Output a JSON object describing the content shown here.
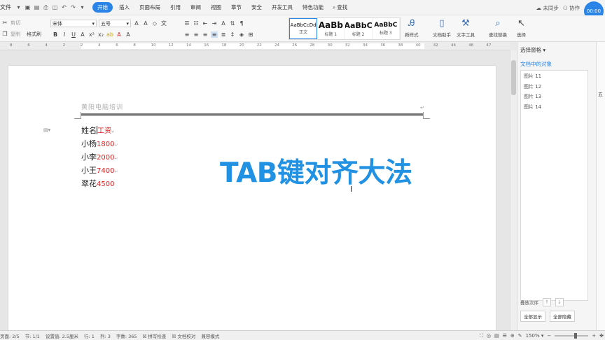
{
  "menu": {
    "file": "文件",
    "tabs": [
      "开始",
      "插入",
      "页面布局",
      "引用",
      "审阅",
      "视图",
      "章节",
      "安全",
      "开发工具",
      "特色功能"
    ],
    "active_tab": "开始",
    "search": "查找",
    "sync": "未同步",
    "collab": "协作",
    "timer": "00:00"
  },
  "ribbon": {
    "cut": "剪切",
    "copy": "复制",
    "format_painter": "格式刷",
    "font_name": "宋体",
    "font_size": "五号",
    "styles": [
      {
        "sample": "AaBbCcDd",
        "name": "正文"
      },
      {
        "sample": "AaBb",
        "name": "标题 1"
      },
      {
        "sample": "AaBbC",
        "name": "标题 2"
      },
      {
        "sample": "AaBbC",
        "name": "标题 3"
      }
    ],
    "new_style": "新样式",
    "doc_assistant": "文档助手",
    "text_tools": "文字工具",
    "find_replace": "查找替换",
    "select": "选择"
  },
  "ruler": [
    "8",
    "6",
    "4",
    "2",
    "2",
    "4",
    "6",
    "8",
    "10",
    "12",
    "14",
    "16",
    "18",
    "20",
    "22",
    "24",
    "26",
    "28",
    "30",
    "32",
    "34",
    "36",
    "38",
    "40",
    "42",
    "44",
    "46",
    "47"
  ],
  "document": {
    "header": "黄阳电脑培训",
    "rows": [
      {
        "name": "姓名",
        "value": "工资"
      },
      {
        "name": "小杨",
        "value": "1800"
      },
      {
        "name": "小李",
        "value": "2000"
      },
      {
        "name": "小王",
        "value": "7400"
      },
      {
        "name": "翠花",
        "value": "4500"
      }
    ],
    "overlay_title": "TAB键对齐大法"
  },
  "selection_pane": {
    "title": "选择窗格",
    "subtitle": "文档中的对象",
    "items": [
      "图片 11",
      "图片 12",
      "图片 13",
      "图片 14"
    ],
    "order_label": "叠放次序",
    "show_all": "全部显示",
    "hide_all": "全部隐藏"
  },
  "right_strip": [
    "五"
  ],
  "status": {
    "page": "页面: 2/5",
    "section": "节: 1/1",
    "position": "设置值: 2.5厘米",
    "line": "行: 1",
    "column": "列: 3",
    "word_count": "字数: 365",
    "spell_check": "拼写检查",
    "doc_check": "文档校对",
    "compat_mode": "兼容模式",
    "zoom": "150%"
  },
  "colors": {
    "accent": "#2a83e6",
    "overlay_title": "#2191e3",
    "value_red": "#e02020"
  }
}
